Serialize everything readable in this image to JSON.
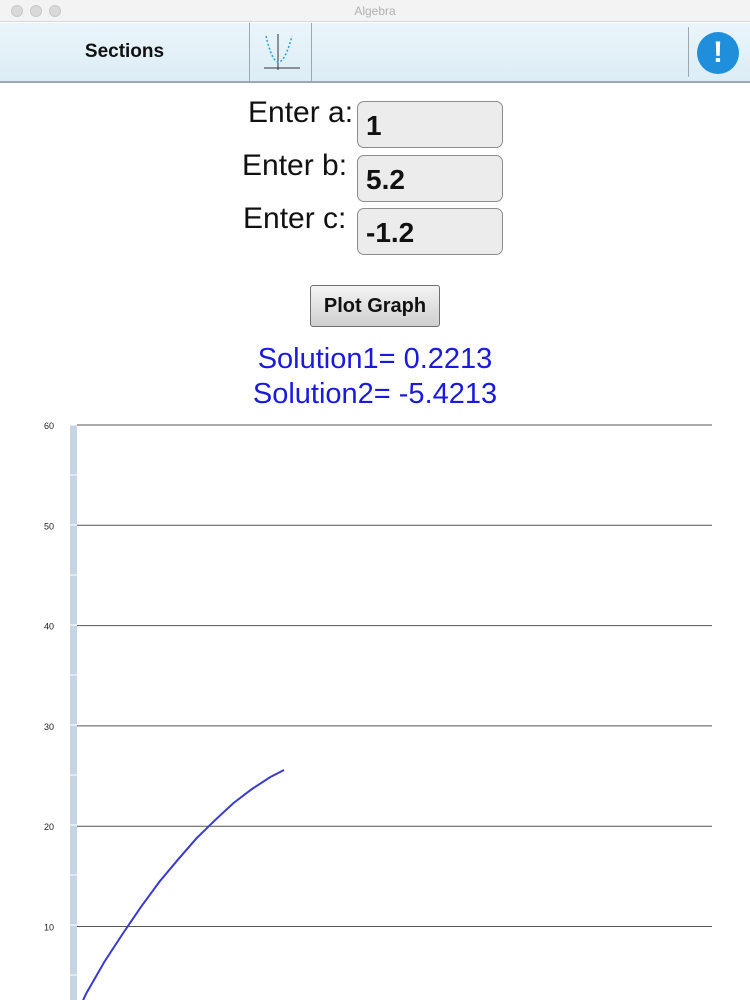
{
  "window": {
    "title": "Algebra"
  },
  "toolbar": {
    "sections_label": "Sections",
    "graph_icon": "parabola-graph-icon",
    "info_icon": "exclamation-info-icon",
    "info_symbol": "!"
  },
  "form": {
    "a_label": "Enter a:",
    "a_value": "1",
    "b_label": "Enter b:",
    "b_value": "5.2",
    "c_label": "Enter c:",
    "c_value": "-1.2",
    "plot_button": "Plot Graph"
  },
  "results": {
    "solution1": "Solution1= 0.2213",
    "solution2": "Solution2= -5.4213"
  },
  "colors": {
    "accent": "#1f8fdc",
    "solution_text": "#1a1adf",
    "curve": "#3a3ad0",
    "axis_bar": "#c5d5e4",
    "gridline": "#555555"
  },
  "chart_data": {
    "type": "line",
    "title": "",
    "xlabel": "",
    "ylabel": "",
    "ylim": [
      0,
      60
    ],
    "yticks": [
      "10",
      "20",
      "30",
      "40",
      "50",
      "60"
    ],
    "grid": true,
    "series": [
      {
        "x": [
          -7.15,
          -6.8,
          -6.4,
          -6.0,
          -5.6,
          -5.2,
          -4.8,
          -4.4,
          -4.0,
          -3.6,
          -3.2,
          -2.8,
          -2.5
        ],
        "values": [
          -0.2,
          3.3,
          6.5,
          9.3,
          12.0,
          14.5,
          16.7,
          18.8,
          20.6,
          22.3,
          23.7,
          24.9,
          25.6
        ]
      }
    ]
  }
}
